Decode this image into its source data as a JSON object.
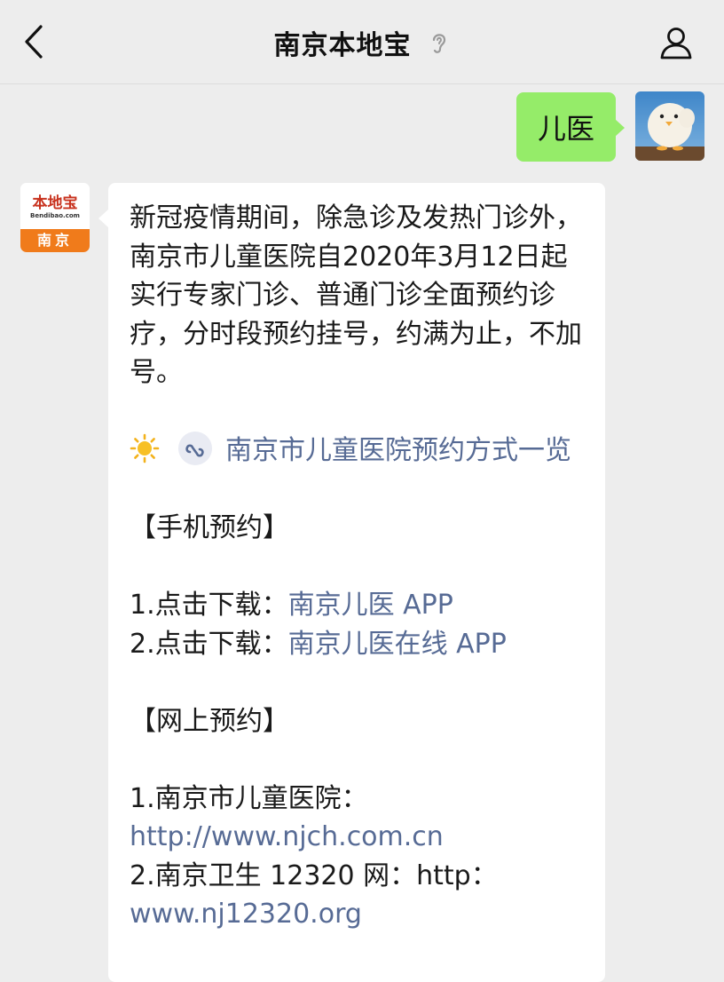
{
  "header": {
    "title": "南京本地宝",
    "back_icon": "chevron-left-icon",
    "ear_icon": "ear-icon",
    "profile_icon": "person-icon"
  },
  "outgoing": {
    "text": "儿医",
    "bubble_color": "#95ec69",
    "avatar_icon": "white-bird-avatar"
  },
  "incoming": {
    "avatar": {
      "brand_name": "本地宝",
      "brand_url": "Bendibao.com",
      "city": "南京",
      "accent": "#f07b1b"
    },
    "intro": "新冠疫情期间，除急诊及发热门诊外，南京市儿童医院自2020年3月12日起实行专家门诊、普通门诊全面预约诊疗，分时段预约挂号，约满为止，不加号。",
    "mini_program_link": "南京市儿童医院预约方式一览",
    "mobile_section": "【手机预约】",
    "mobile_items": [
      {
        "prefix": "1.点击下载：",
        "link": "南京儿医 APP"
      },
      {
        "prefix": "2.点击下载：",
        "link": "南京儿医在线 APP"
      }
    ],
    "online_section": "【网上预约】",
    "online_items": [
      {
        "prefix": "1.南京市儿童医院：",
        "link": "http://www.njch.com.cn"
      },
      {
        "prefix": "2.南京卫生 12320 网：http：",
        "link": "www.nj12320.org"
      }
    ],
    "link_color": "#576b95"
  }
}
